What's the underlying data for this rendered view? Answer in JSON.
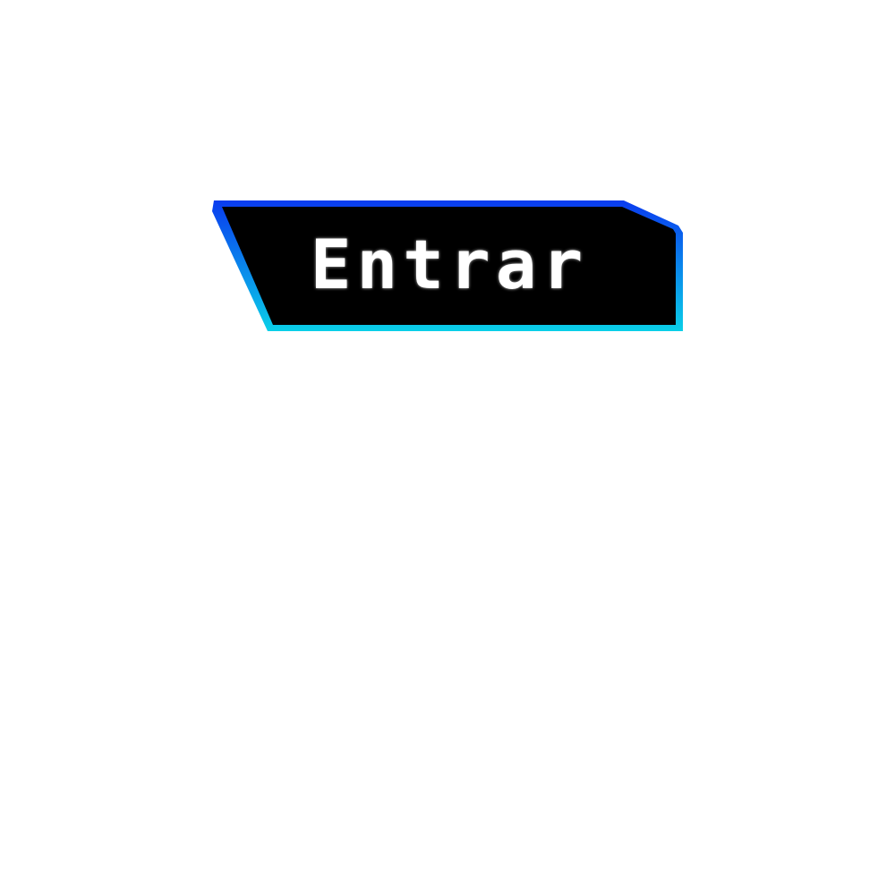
{
  "button": {
    "label": "Entrar",
    "text_color": "#ffffff",
    "fill_color": "#000000",
    "border_gradient": [
      "#0a3bef",
      "#0acfe8"
    ]
  }
}
